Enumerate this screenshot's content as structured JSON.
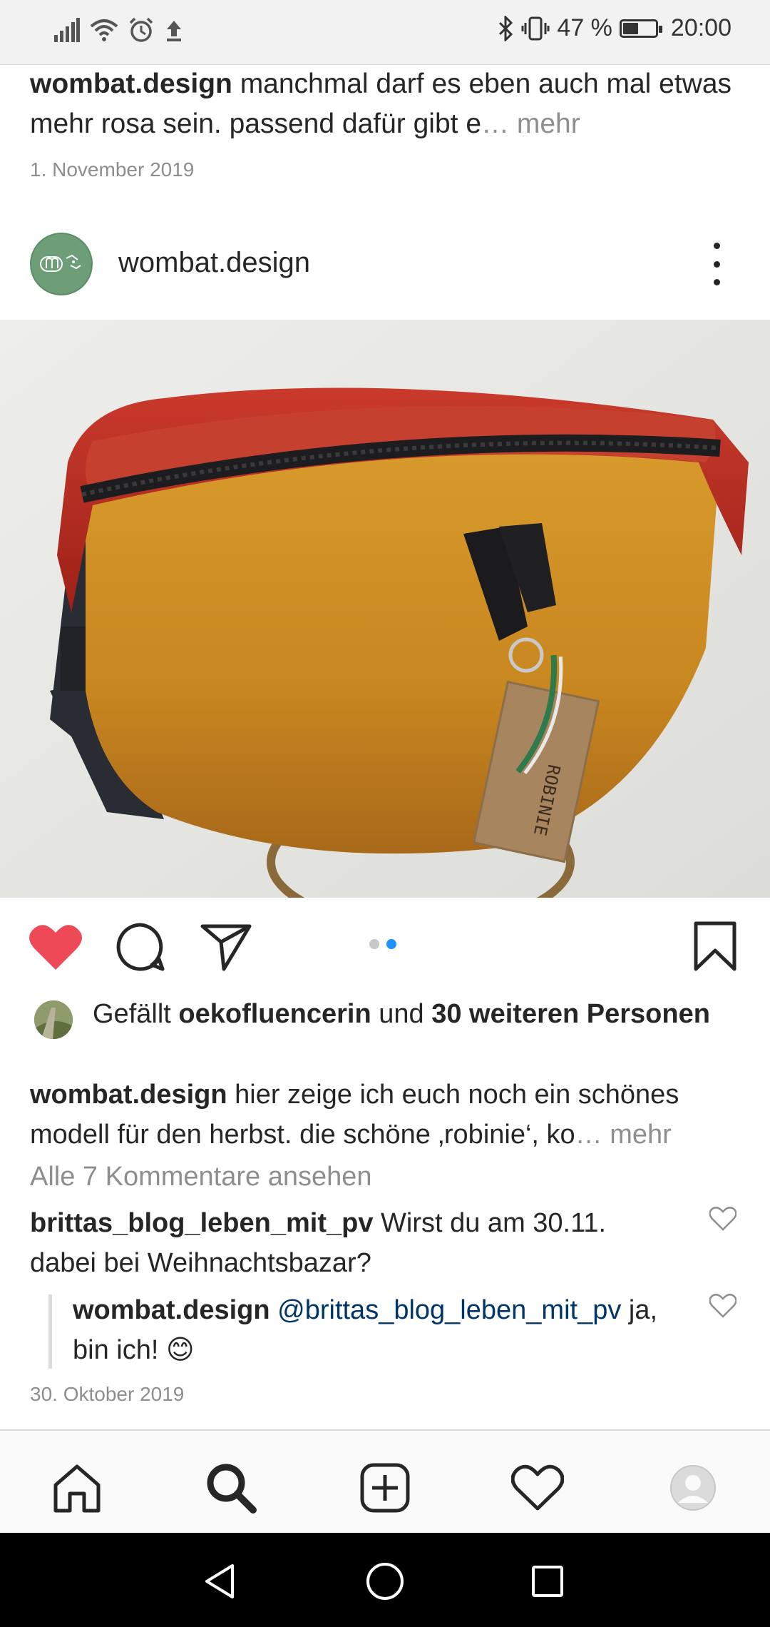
{
  "status_bar": {
    "battery_percent": "47 %",
    "battery_level": 0.47,
    "time": "20:00"
  },
  "previous_post": {
    "username": "wombat.design",
    "caption": " manchmal darf es eben auch mal etwas mehr rosa sein. passend dafür gibt e",
    "more": "… mehr",
    "date": "1. November 2019"
  },
  "post": {
    "username": "wombat.design",
    "photo_tag_text": "ROBINIE",
    "carousel": {
      "count": 2,
      "active_index": 2
    },
    "likes": {
      "prefix": "Gefällt ",
      "user": "oekofluencerin",
      "middle": " und ",
      "others": "30 weiteren Personen"
    },
    "caption_user": "wombat.design",
    "caption_text": " hier zeige ich euch noch ein schönes modell für den herbst. die schöne ‚robinie‘, ko",
    "caption_more": "… mehr",
    "view_comments": "Alle 7 Kommentare ansehen",
    "comments": [
      {
        "user": "brittas_blog_leben_mit_pv",
        "text": " Wirst du am 30.11. dabei bei Weihnachtsbazar?"
      },
      {
        "user": "wombat.design",
        "mention": " @brittas_blog_leben_mit_pv",
        "text": " ja, bin ich! 😊"
      }
    ],
    "date": "30. Oktober 2019"
  },
  "colors": {
    "liked_heart": "#ed4956",
    "carousel_active": "#1e90ff",
    "mention": "#003569"
  },
  "icons": {
    "actions": [
      "heart-icon",
      "comment-icon",
      "share-icon",
      "bookmark-icon"
    ],
    "nav": [
      "home-icon",
      "search-icon",
      "add-post-icon",
      "activity-heart-icon",
      "profile-avatar-icon"
    ],
    "system": [
      "back-icon",
      "home-circle-icon",
      "recents-icon"
    ]
  }
}
